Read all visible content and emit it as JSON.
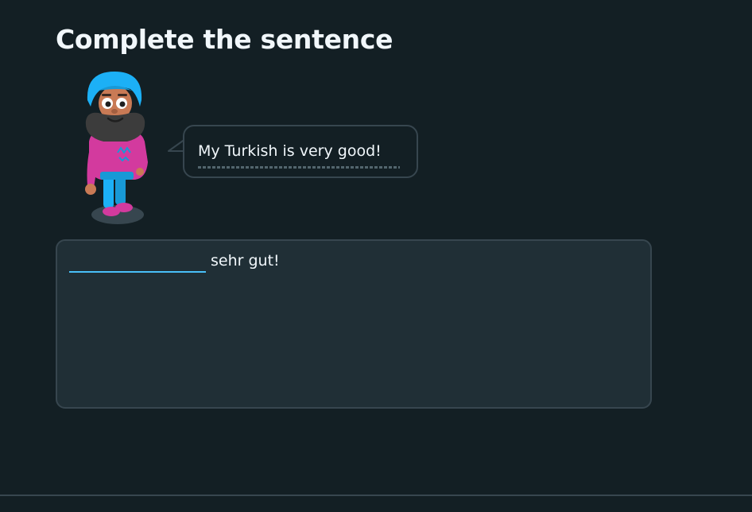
{
  "challenge": {
    "title": "Complete the sentence",
    "prompt_text": "My Turkish is very good!",
    "character_icon": "turbaned-character-icon"
  },
  "answer": {
    "blank_value": "",
    "sentence_after_blank": "sehr gut!"
  },
  "colors": {
    "background": "#131f24",
    "box_background": "#202f36",
    "border": "#37464f",
    "accent_blue": "#49c0f8",
    "text": "#f1f7fb"
  }
}
